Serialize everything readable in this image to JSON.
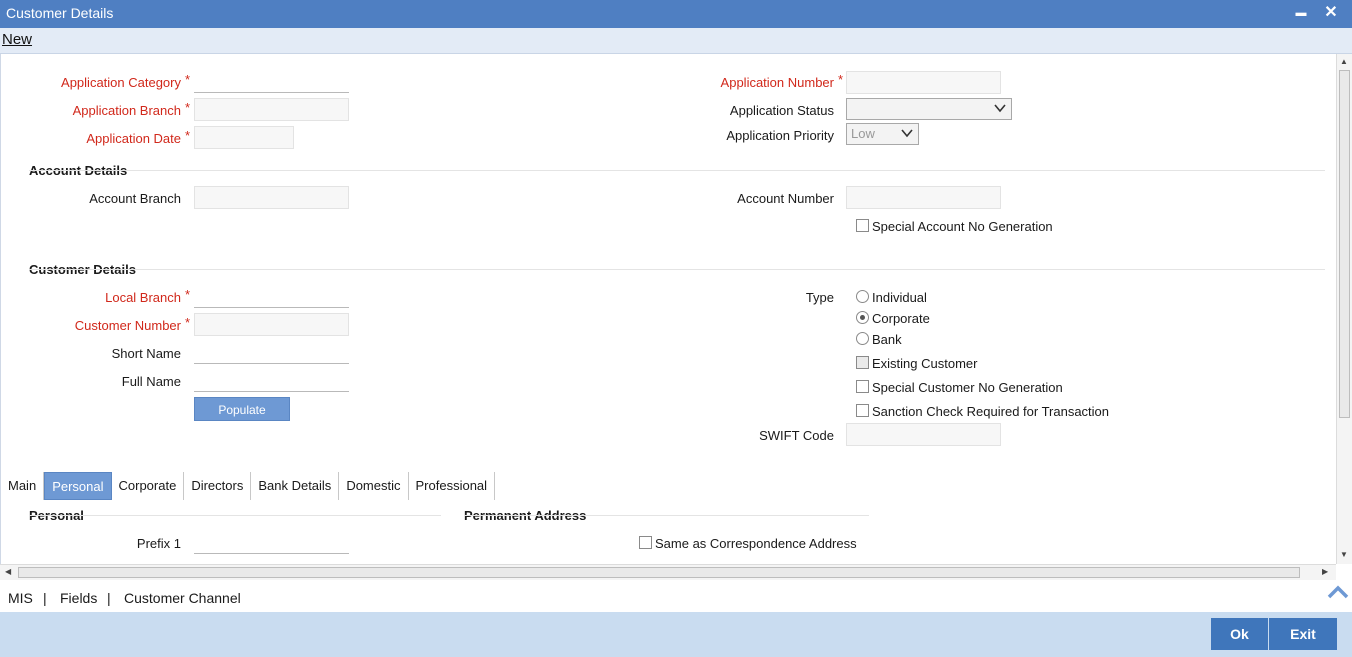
{
  "window": {
    "title": "Customer Details",
    "minimize": "▬",
    "close": "✕"
  },
  "menu": {
    "new_label": "New"
  },
  "application": {
    "category_label": "Application Category",
    "branch_label": "Application Branch",
    "date_label": "Application Date",
    "number_label": "Application Number",
    "status_label": "Application Status",
    "priority_label": "Application Priority",
    "status_value": "",
    "priority_value": "Low",
    "required_mark": "*"
  },
  "account": {
    "section_title": "Account Details",
    "branch_label": "Account Branch",
    "number_label": "Account Number",
    "special_no_label": "Special Account No Generation"
  },
  "customer": {
    "section_title": "Customer Details",
    "local_branch_label": "Local Branch",
    "customer_number_label": "Customer Number",
    "short_name_label": "Short Name",
    "full_name_label": "Full Name",
    "populate_label": "Populate",
    "type_label": "Type",
    "type_options": [
      "Individual",
      "Corporate",
      "Bank"
    ],
    "type_selected": "Corporate",
    "existing_customer_label": "Existing Customer",
    "special_customer_no_label": "Special Customer No Generation",
    "sanction_check_label": "Sanction Check Required for Transaction",
    "swift_code_label": "SWIFT Code"
  },
  "tabs": [
    "Main",
    "Personal",
    "Corporate",
    "Directors",
    "Bank Details",
    "Domestic",
    "Professional"
  ],
  "active_tab": "Personal",
  "personal": {
    "section_title": "Personal",
    "prefix1_label": "Prefix 1",
    "permanent_address_title": "Permanent Address",
    "same_as_corr_label": "Same as Correspondence Address"
  },
  "footer_links": [
    "MIS",
    "|",
    "Fields",
    "|",
    "Customer Channel"
  ],
  "buttons": {
    "ok": "Ok",
    "exit": "Exit"
  }
}
